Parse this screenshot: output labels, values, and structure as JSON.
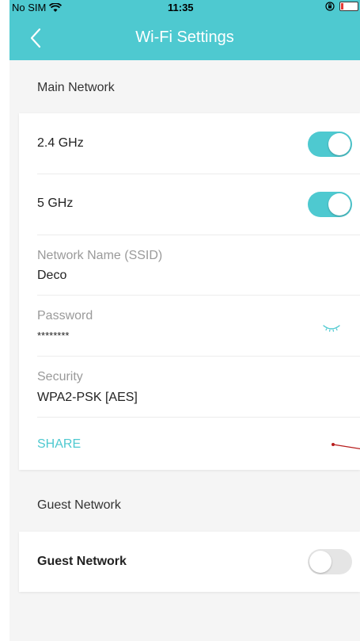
{
  "status_bar": {
    "carrier": "No SIM",
    "time": "11:35"
  },
  "nav": {
    "title": "Wi-Fi Settings"
  },
  "main_network": {
    "section_label": "Main Network",
    "band_24": {
      "label": "2.4 GHz",
      "enabled": true
    },
    "band_5": {
      "label": "5 GHz",
      "enabled": true
    },
    "ssid": {
      "label": "Network Name (SSID)",
      "value": "Deco"
    },
    "password": {
      "label": "Password",
      "value": "********"
    },
    "security": {
      "label": "Security",
      "value": "WPA2-PSK [AES]"
    },
    "share_label": "SHARE"
  },
  "guest_network": {
    "section_label": "Guest Network",
    "toggle": {
      "label": "Guest Network",
      "enabled": false
    }
  },
  "colors": {
    "accent": "#4ec9d0",
    "toggle_off": "#e5e5e5",
    "annotation": "#b71c1c"
  }
}
